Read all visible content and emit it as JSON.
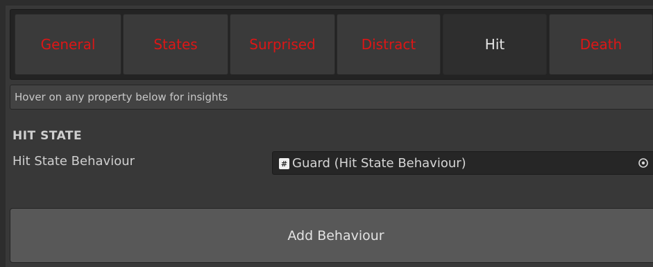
{
  "tabs": {
    "items": [
      {
        "label": "General",
        "active": false
      },
      {
        "label": "States",
        "active": false
      },
      {
        "label": "Surprised",
        "active": false
      },
      {
        "label": "Distract",
        "active": false
      },
      {
        "label": "Hit",
        "active": true
      },
      {
        "label": "Death",
        "active": false
      }
    ],
    "inactive_color": "#dd1616",
    "active_color": "#e6e6e6"
  },
  "hint": {
    "text": "Hover on any property below for insights"
  },
  "section": {
    "header": "HIT STATE",
    "property_label": "Hit State Behaviour",
    "field_value": "Guard (Hit State Behaviour)",
    "field_icon": "script-icon",
    "picker_icon": "object-picker-icon"
  },
  "actions": {
    "add_label": "Add Behaviour"
  }
}
